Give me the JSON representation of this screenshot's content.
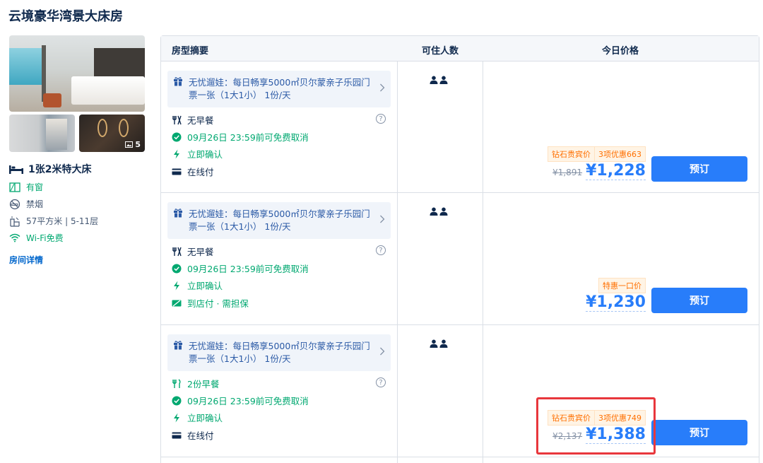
{
  "room": {
    "title": "云境豪华湾景大床房",
    "photo_count": "5",
    "bed_type": "1张2米特大床",
    "features": [
      {
        "icon": "window-icon",
        "label": "有窗"
      },
      {
        "icon": "no-smoking-icon",
        "label": "禁烟"
      },
      {
        "icon": "area-icon",
        "label": "57平方米 | 5-11层"
      },
      {
        "icon": "wifi-icon",
        "label": "Wi-Fi免费"
      }
    ],
    "detail_link": "房间详情"
  },
  "table": {
    "headers": {
      "summary": "房型摘要",
      "guests": "可住人数",
      "price": "今日价格"
    }
  },
  "offers": [
    {
      "gift": "无忧遛娃：每日畅享5000㎡贝尔蒙亲子乐园门票一张（1大1小） 1份/天",
      "meal": "无早餐",
      "cancel": "09月26日 23:59前可免费取消",
      "confirm": "立即确认",
      "payment": "在线付",
      "badges": [
        "钻石贵宾价",
        "3项优惠663"
      ],
      "original_price": "¥1,891",
      "price": "¥1,228",
      "book_label": "预订"
    },
    {
      "gift": "无忧遛娃：每日畅享5000㎡贝尔蒙亲子乐园门票一张（1大1小） 1份/天",
      "meal": "无早餐",
      "cancel": "09月26日 23:59前可免费取消",
      "confirm": "立即确认",
      "payment": "到店付 · 需担保",
      "badges": [
        "特惠一口价"
      ],
      "original_price": "",
      "price": "¥1,230",
      "book_label": "预订"
    },
    {
      "gift": "无忧遛娃：每日畅享5000㎡贝尔蒙亲子乐园门票一张（1大1小） 1份/天",
      "meal": "2份早餐",
      "cancel": "09月26日 23:59前可免费取消",
      "confirm": "立即确认",
      "payment": "在线付",
      "badges": [
        "钻石贵宾价",
        "3项优惠749"
      ],
      "original_price": "¥2,137",
      "price": "¥1,388",
      "book_label": "预订"
    }
  ],
  "colors": {
    "accent": "#287dfa",
    "green": "#00a870",
    "orange": "#ff6f00",
    "highlight": "#e8373c"
  }
}
